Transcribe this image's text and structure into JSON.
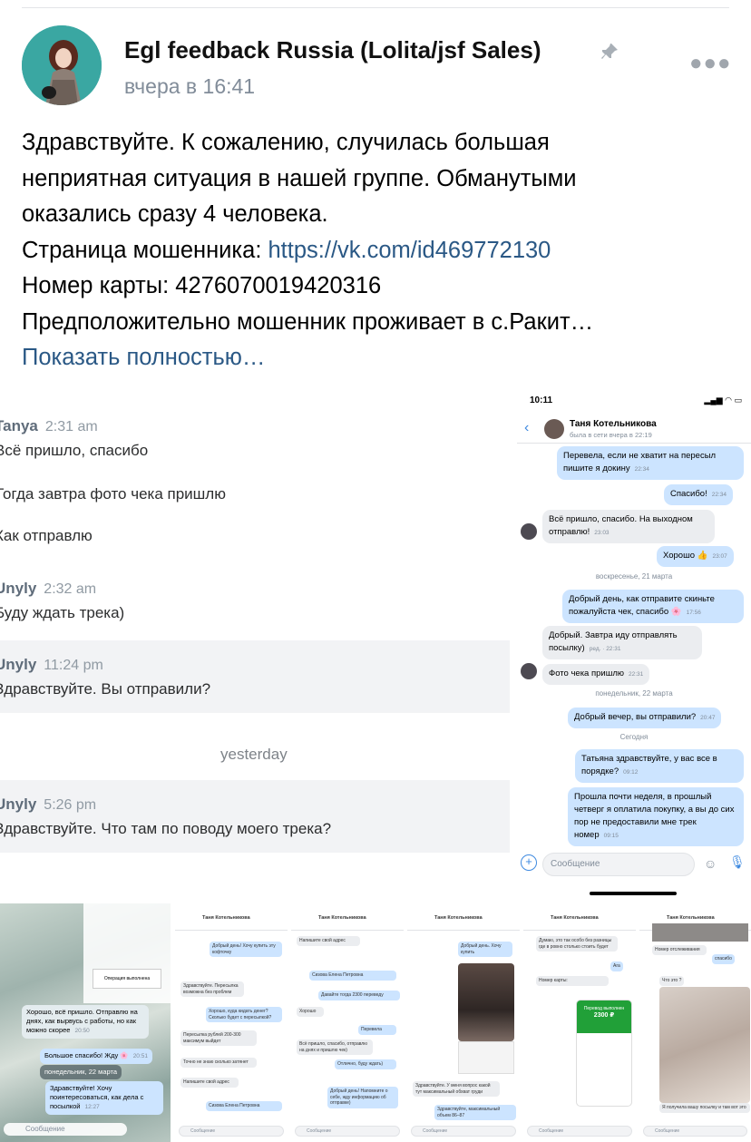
{
  "post": {
    "group_name": "Egl feedback Russia (Lolita/jsf Sales)",
    "time": "вчера в 16:41",
    "lines": [
      "Здравствуйте. К сожалению, случилась большая",
      "неприятная ситуация в нашей группе. Обманутыми",
      "оказались сразу 4 человека."
    ],
    "scammer_label": "Страница мошенника: ",
    "scammer_link": "https://vk.com/id469772130",
    "card_line": "Номер карты: 4276070019420316",
    "location_line": "Предположительно мошенник проживает в с.Ракит…",
    "show_more": "Показать полностью…"
  },
  "desktop_chat": {
    "messages": [
      {
        "name": "Tanya",
        "time": "2:31 am",
        "lines": [
          "Всё пришло, спасибо",
          "Тогда завтра фото чека пришлю",
          "Как отправлю"
        ]
      },
      {
        "name": "Unyly",
        "time": "2:32 am",
        "lines": [
          "Буду ждать трека)"
        ]
      },
      {
        "name": "Unyly",
        "time": "11:24 pm",
        "lines": [
          "Здравствуйте. Вы отправили?"
        ]
      },
      {
        "name": "Unyly",
        "time": "5:26 pm",
        "lines": [
          "Здравствуйте. Что там по поводу моего трека?"
        ]
      }
    ],
    "separator": "yesterday"
  },
  "phone_chat": {
    "status_time": "10:11",
    "contact_name": "Таня Котельникова",
    "contact_status": "была в сети вчера в 22:19",
    "messages": [
      {
        "dir": "out",
        "text": "Перевела, если не хватит на пересыл пишите я докину",
        "time": "22:34"
      },
      {
        "dir": "out",
        "text": "Спасибо!",
        "time": "22:34"
      },
      {
        "dir": "in",
        "text": "Всё пришло, спасибо. На выходном отправлю!",
        "time": "23:03"
      },
      {
        "dir": "out",
        "text": "Хорошо 👍",
        "time": "23:07"
      },
      {
        "dir": "out",
        "text": "Добрый день, как отправите скиньте пожалуйста чек, спасибо 🌸",
        "time": "17:56"
      },
      {
        "dir": "in",
        "text": "Добрый. Завтра иду отправлять посылку)",
        "time": "ред. · 22:31"
      },
      {
        "dir": "in",
        "text": "Фото чека пришлю",
        "time": "22:31"
      },
      {
        "dir": "out",
        "text": "Добрый вечер, вы отправили?",
        "time": "20:47"
      },
      {
        "dir": "out",
        "text": "Татьяна здравствуйте, у вас все в порядке?",
        "time": "09:12"
      },
      {
        "dir": "out",
        "text": "Прошла почти неделя, в прошлый четверг я оплатила покупку, а вы до сих пор не предоставили мне трек номер",
        "time": "09:15"
      }
    ],
    "separators": [
      "воскресенье, 21 марта",
      "понедельник, 22 марта",
      "Сегодня"
    ],
    "input_placeholder": "Сообщение"
  },
  "thumbnails": {
    "sea": {
      "messages": [
        {
          "text": "Хорошо, всё пришло. Отправлю на днях, как вырвусь с работы, но как можно скорее",
          "time": "20:50"
        },
        {
          "text": "Большое спасибо! Жду 🌸",
          "time": "20:51"
        },
        {
          "text": "Здравствуйте! Хочу поинтересоваться, как дела с посылкой",
          "time": "12:27"
        }
      ],
      "separator": "понедельник, 22 марта",
      "card_label": "Операция выполнена"
    },
    "t2": {
      "name": "Таня Котельникова",
      "msgs": [
        "Добрый день! Хочу купить эту кофточку",
        "Здравствуйте. Пересылка возможна без проблем",
        "Хорошо, куда кидать денег? Сколько будет с пересылкой?",
        "Пересылка рублей 200-300 максимум выйдет",
        "Точно не знаю сколько затянет",
        "Напишите свой адрес",
        "Сизова Елена Петровна"
      ]
    },
    "t3": {
      "name": "Таня Котельникова",
      "msgs": [
        "Напишите свой адрес",
        "Сизова Елена Петровна",
        "Давайте тогда 2300 переведу",
        "Хорошо",
        "Перевела",
        "Всё пришло, спасибо, отправлю на днях и пришлю чек)",
        "Отлично, буду ждать)",
        "Добрый день! Напомните о себе, жду информацию об отправке)"
      ]
    },
    "t4": {
      "name": "Таня Котельникова",
      "msgs": [
        "Добрый день. Хочу купить",
        "Здравствуйте. У меня вопрос какой тут максимальный обхват груди",
        "Здравствуйте, максимальный объем 86–87"
      ]
    },
    "t5": {
      "name": "Таня Котельникова",
      "msgs": [
        "Думаю, это так особо без разницы где в ровно столько стоить будет",
        "Ага",
        "Номер карты:",
        "Перевод выполнен",
        "2300 ₽"
      ]
    },
    "t6": {
      "name": "Таня Котельникова",
      "msgs": [
        "Номер отслеживания",
        "спасибо",
        "Что это ?",
        "Я получила вашу посылку и там вот это"
      ]
    },
    "input_placeholder": "Сообщение"
  }
}
